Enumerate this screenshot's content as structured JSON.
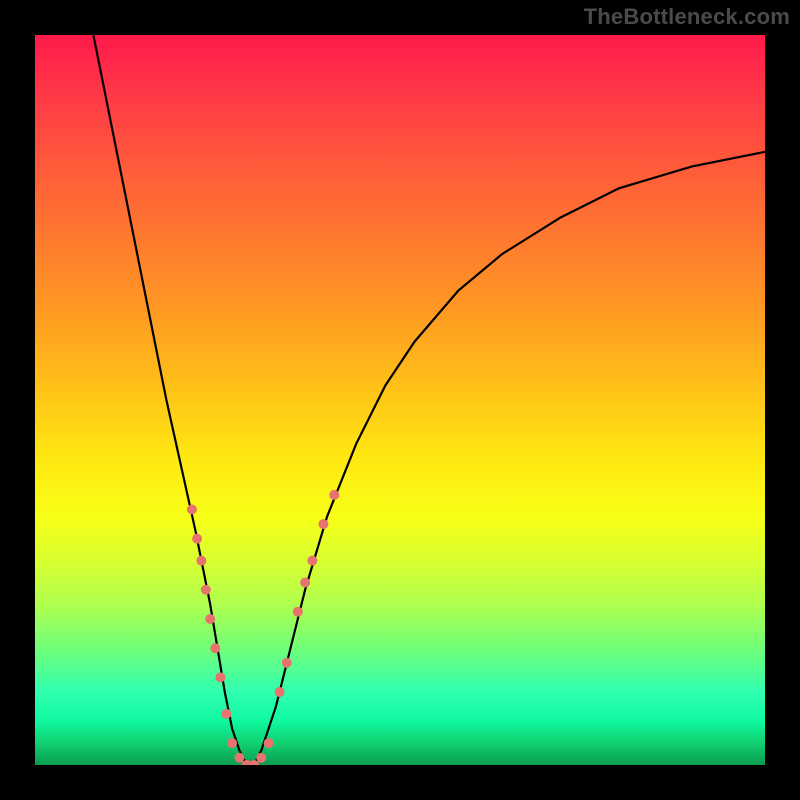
{
  "watermark": "TheBottleneck.com",
  "chart_data": {
    "type": "line",
    "title": "",
    "subtitle": "",
    "xlabel": "",
    "ylabel": "",
    "xlim": [
      0,
      100
    ],
    "ylim": [
      0,
      100
    ],
    "x_axis_visible": false,
    "y_axis_visible": false,
    "background_gradient": {
      "direction": "vertical",
      "stops": [
        {
          "pos": 0.0,
          "color": "#ff1a4a"
        },
        {
          "pos": 0.3,
          "color": "#ff7a2f"
        },
        {
          "pos": 0.58,
          "color": "#ffe812"
        },
        {
          "pos": 0.78,
          "color": "#b0ff4e"
        },
        {
          "pos": 0.94,
          "color": "#10f8a0"
        },
        {
          "pos": 1.0,
          "color": "#0a9c50"
        }
      ]
    },
    "series": [
      {
        "name": "bottleneck-v-curve",
        "type": "line",
        "color": "#000000",
        "x": [
          8,
          10,
          12,
          14,
          16,
          18,
          20,
          22,
          24,
          25,
          26,
          27,
          28,
          29,
          30,
          31,
          33,
          35,
          37,
          40,
          44,
          48,
          52,
          58,
          64,
          72,
          80,
          90,
          100
        ],
        "y": [
          100,
          90,
          80,
          70,
          60,
          50,
          41,
          32,
          22,
          16,
          10,
          5,
          2,
          0,
          0,
          2,
          8,
          16,
          24,
          34,
          44,
          52,
          58,
          65,
          70,
          75,
          79,
          82,
          84
        ]
      }
    ],
    "markers": {
      "name": "highlight-dots",
      "color": "#e6736e",
      "radius": 5,
      "points": [
        {
          "x": 21.5,
          "y": 35
        },
        {
          "x": 22.2,
          "y": 31
        },
        {
          "x": 22.8,
          "y": 28
        },
        {
          "x": 23.4,
          "y": 24
        },
        {
          "x": 24.0,
          "y": 20
        },
        {
          "x": 24.7,
          "y": 16
        },
        {
          "x": 25.4,
          "y": 12
        },
        {
          "x": 26.2,
          "y": 7
        },
        {
          "x": 27.0,
          "y": 3
        },
        {
          "x": 28.0,
          "y": 1
        },
        {
          "x": 29.0,
          "y": 0
        },
        {
          "x": 30.0,
          "y": 0
        },
        {
          "x": 31.0,
          "y": 1
        },
        {
          "x": 32.0,
          "y": 3
        },
        {
          "x": 33.5,
          "y": 10
        },
        {
          "x": 34.5,
          "y": 14
        },
        {
          "x": 36.0,
          "y": 21
        },
        {
          "x": 37.0,
          "y": 25
        },
        {
          "x": 38.0,
          "y": 28
        },
        {
          "x": 39.5,
          "y": 33
        },
        {
          "x": 41.0,
          "y": 37
        }
      ]
    }
  }
}
